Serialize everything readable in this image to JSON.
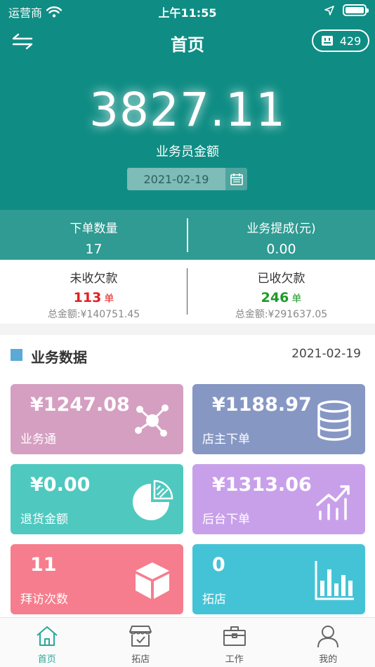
{
  "status_bar": {
    "carrier": "运营商",
    "time": "上午11:55"
  },
  "nav": {
    "title": "首页",
    "store_count": "429"
  },
  "summary": {
    "amount": "3827.11",
    "amount_label": "业务员金额",
    "date": "2021-02-19"
  },
  "stats": [
    {
      "label": "下单数量",
      "value": "17"
    },
    {
      "label": "业务提成(元)",
      "value": "0.00"
    }
  ],
  "debts": [
    {
      "label": "未收欠款",
      "count": "113",
      "unit": "单",
      "total": "总金额:¥140751.45",
      "color": "#e41e1e"
    },
    {
      "label": "已收欠款",
      "count": "246",
      "unit": "单",
      "total": "总金额:¥291637.05",
      "color": "#1e9a27"
    }
  ],
  "section": {
    "title": "业务数据",
    "date": "2021-02-19"
  },
  "cards": [
    {
      "value": "¥1247.08",
      "label": "业务通",
      "icon": "network-icon",
      "color": "#d59fc1"
    },
    {
      "value": "¥1188.97",
      "label": "店主下单",
      "icon": "database-icon",
      "color": "#8697c4"
    },
    {
      "value": "¥0.00",
      "label": "退货金额",
      "icon": "pie-chart-icon",
      "color": "#4fc9bf"
    },
    {
      "value": "¥1313.06",
      "label": "后台下单",
      "icon": "trend-up-icon",
      "color": "#c8a0ea"
    },
    {
      "value": "11",
      "label": "拜访次数",
      "icon": "cube-icon",
      "color": "#f67d8d"
    },
    {
      "value": "0",
      "label": "拓店",
      "icon": "bar-chart-icon",
      "color": "#45c3d6"
    }
  ],
  "tabs": [
    {
      "label": "首页",
      "icon": "home-icon",
      "active": true
    },
    {
      "label": "拓店",
      "icon": "storefront-icon"
    },
    {
      "label": "工作",
      "icon": "briefcase-icon"
    },
    {
      "label": "我的",
      "icon": "user-icon"
    }
  ]
}
